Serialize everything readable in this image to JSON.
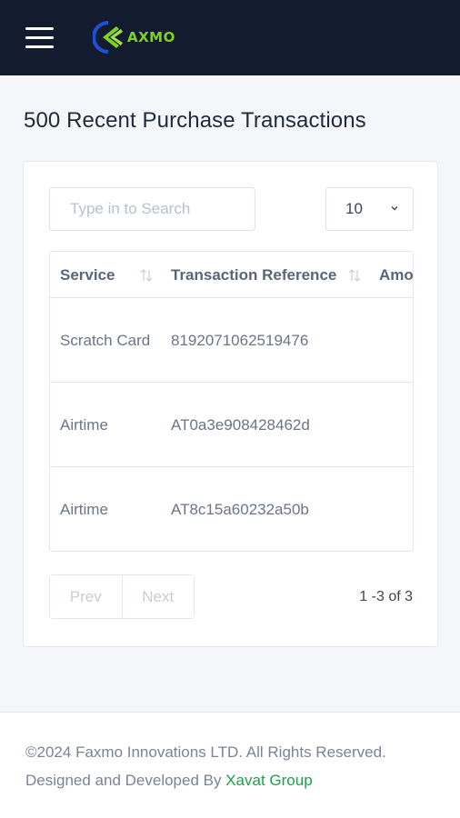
{
  "header": {
    "logo_text": "AXMO",
    "colors": {
      "background": "#131b2e",
      "logo_green": "#7ed321",
      "logo_blue": "#1e4fd8"
    }
  },
  "page": {
    "title": "500 Recent Purchase Transactions"
  },
  "search": {
    "placeholder": "Type in to Search",
    "value": ""
  },
  "page_size": {
    "selected": "10"
  },
  "table": {
    "headers": {
      "service": "Service",
      "reference": "Transaction Reference",
      "amount": "Amount"
    },
    "rows": [
      {
        "service": "Scratch Card",
        "reference": "8192071062519476"
      },
      {
        "service": "Airtime",
        "reference": "AT0a3e908428462d"
      },
      {
        "service": "Airtime",
        "reference": "AT8c15a60232a50b"
      }
    ]
  },
  "pagination": {
    "prev_label": "Prev",
    "next_label": "Next",
    "info": "1 -3 of 3"
  },
  "footer": {
    "copyright": "©2024 Faxmo Innovations LTD. All Rights Reserved.",
    "designed_prefix": "Designed and Developed By ",
    "designed_link": "Xavat Group",
    "link_color": "#1e9e4b"
  },
  "icons": [
    "hamburger-menu-icon",
    "logo-icon",
    "chevron-down-icon",
    "sort-icon",
    "more-options-icon"
  ]
}
